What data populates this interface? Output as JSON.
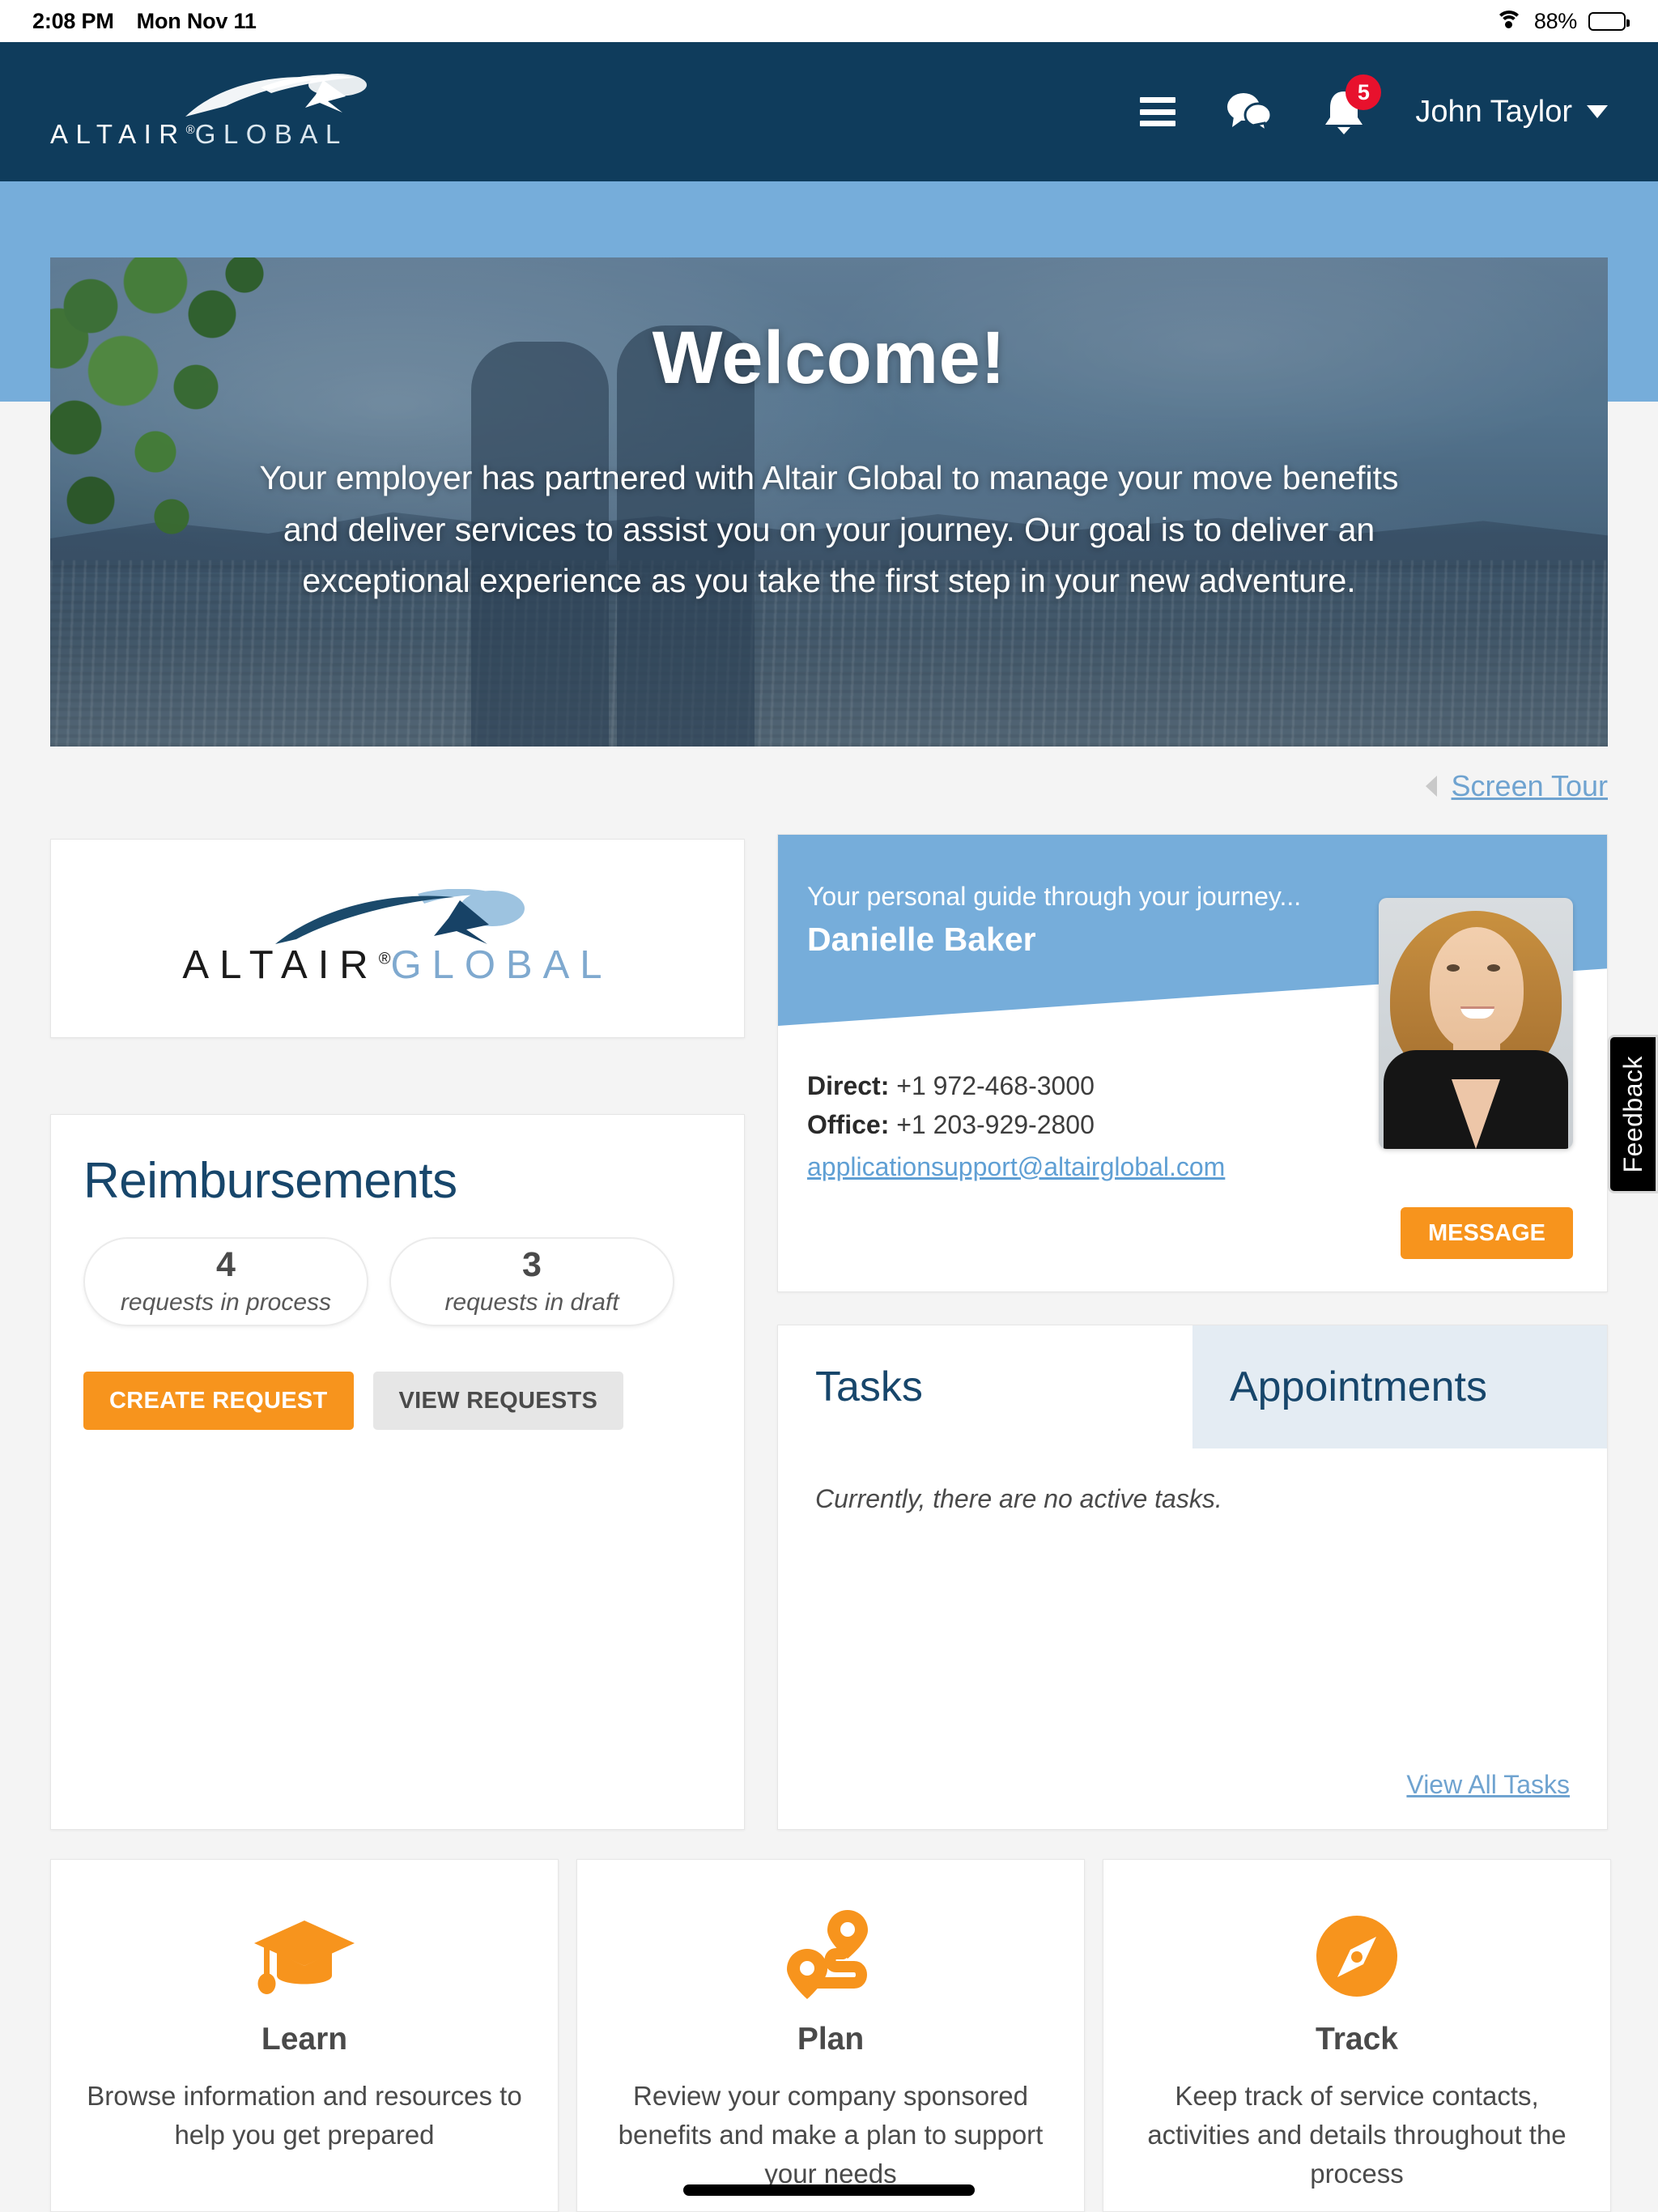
{
  "status_bar": {
    "time": "2:08 PM",
    "date": "Mon Nov 11",
    "battery_percent": "88%",
    "wifi_icon": "wifi-icon",
    "battery_icon": "battery-icon"
  },
  "header": {
    "logo_text_primary": "ALTAI R",
    "logo_text_altair": "ALTAIR",
    "logo_text_global": "GLOBAL",
    "logo_registered": "®",
    "menu_icon": "hamburger-menu-icon",
    "chat_icon": "chat-bubbles-icon",
    "bell_icon": "notification-bell-icon",
    "notification_count": "5",
    "user_name": "John Taylor",
    "caret_icon": "chevron-down-icon"
  },
  "hero": {
    "title": "Welcome!",
    "subtitle": "Your employer has partnered with Altair Global to manage your move benefits and deliver services to assist you on your journey. Our goal is to deliver an exceptional experience as you take the first step in your new adventure."
  },
  "screen_tour": {
    "icon": "video-camera-icon",
    "label": "Screen Tour"
  },
  "logo_card": {
    "text_altair": "ALTAIR",
    "text_global": "GLOBAL",
    "registered": "®"
  },
  "reimbursements": {
    "title": "Reimbursements",
    "stats": [
      {
        "value": "4",
        "label": "requests in process"
      },
      {
        "value": "3",
        "label": "requests in draft"
      }
    ],
    "create_button": "CREATE REQUEST",
    "view_button": "VIEW REQUESTS"
  },
  "guide": {
    "kicker": "Your personal guide through your journey...",
    "name": "Danielle Baker",
    "direct_label": "Direct:",
    "direct_value": "+1 972-468-3000",
    "office_label": "Office:",
    "office_value": "+1 203-929-2800",
    "email": "applicationsupport@altairglobal.com",
    "message_button": "MESSAGE",
    "photo_alt": "advisor-headshot"
  },
  "tasks": {
    "tab_tasks": "Tasks",
    "tab_appointments": "Appointments",
    "active_tab": "Tasks",
    "empty_message": "Currently, there are no active tasks.",
    "view_all": "View All Tasks"
  },
  "feature_cards": [
    {
      "icon": "graduation-cap-icon",
      "title": "Learn",
      "description": "Browse information and resources to help you get prepared"
    },
    {
      "icon": "route-map-pins-icon",
      "title": "Plan",
      "description": "Review your company sponsored benefits and make a plan to support your needs"
    },
    {
      "icon": "compass-icon",
      "title": "Track",
      "description": "Keep track of service contacts, activities and details throughout the process"
    }
  ],
  "feedback": {
    "label": "Feedback"
  },
  "colors": {
    "header_navy": "#0f3c5c",
    "band_blue": "#76adda",
    "accent_orange": "#f7941d",
    "link_blue": "#6fa3d0",
    "badge_red": "#e8112d",
    "page_bg": "#f4f4f4",
    "heading_navy": "#17466b"
  }
}
